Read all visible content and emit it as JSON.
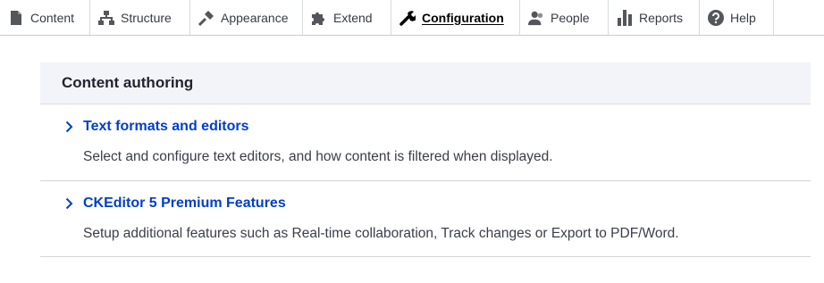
{
  "toolbar": {
    "items": [
      {
        "label": "Content",
        "icon": "content-icon"
      },
      {
        "label": "Structure",
        "icon": "structure-icon"
      },
      {
        "label": "Appearance",
        "icon": "appearance-icon"
      },
      {
        "label": "Extend",
        "icon": "extend-icon"
      },
      {
        "label": "Configuration",
        "icon": "configuration-icon",
        "active": true
      },
      {
        "label": "People",
        "icon": "people-icon"
      },
      {
        "label": "Reports",
        "icon": "reports-icon"
      },
      {
        "label": "Help",
        "icon": "help-icon"
      }
    ]
  },
  "section": {
    "title": "Content authoring",
    "items": [
      {
        "label": "Text formats and editors",
        "description": "Select and configure text editors, and how content is filtered when displayed."
      },
      {
        "label": "CKEditor 5 Premium Features",
        "description": "Setup additional features such as Real-time collaboration, Track changes or Export to PDF/Word."
      }
    ]
  },
  "colors": {
    "link": "#003ecc",
    "header_bg": "#f3f4f9",
    "text": "#222330"
  }
}
